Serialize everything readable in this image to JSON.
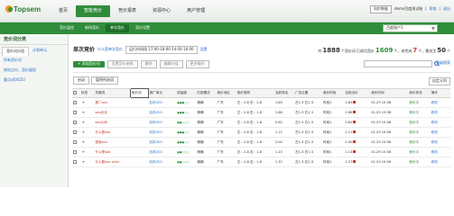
{
  "header": {
    "logo_text": "Topsem",
    "nav": [
      "首页",
      "智能竞价",
      "竞价报表",
      "资源中心",
      "用户管理"
    ],
    "active_nav": 1,
    "top_btn": "同步数据",
    "user": "demo百度测试账",
    "logout_sep": "|",
    "logout": "退出",
    "help": "帮助"
  },
  "subnav": {
    "items": [
      "竞价监控",
      "新排竞价",
      "单次竞价",
      "竞价设置"
    ],
    "active": 2,
    "account": "百度账户1"
  },
  "sidebar": {
    "title": "竞价词分类",
    "tabs": [
      "竞价词分组",
      "计划单元"
    ],
    "links": [
      "所有竞价词",
      "按站点分，竞价展现",
      "重点词OOZU"
    ]
  },
  "main": {
    "title": "单次竞价",
    "title_link": "什么是单次竞价",
    "period": "运行时间段 17:00-18:00 14:00-16:00",
    "set": "设置",
    "stats": {
      "pre1": "共",
      "total": "1888",
      "post1": "个竞价词",
      "pre2": "已成功竞价",
      "success": "1609",
      "post2": "个，未完成",
      "fail": "7",
      "post3": "个，需关注",
      "alert": "50",
      "post4": "个"
    },
    "toolbar": {
      "add": "+ 添加竞价词",
      "b1": "设置竞价参数",
      "b2": "删除",
      "b3": "编辑分组",
      "b4": "更多操作"
    },
    "search_placeholder": "",
    "advanced": "高级搜索",
    "filter": [
      "启动",
      "暂停所选项"
    ],
    "columns_btn": "自定义列"
  },
  "table": {
    "headers": [
      "",
      "状态",
      "关键词",
      "竞价词",
      "推广单元",
      "质量度",
      "匹配模式",
      "竞价地区",
      "竞价规则",
      "当前排名",
      "广告位置",
      "竞价时段",
      "目前出价",
      "竞价时间",
      "竞价状态",
      "操作"
    ],
    "rows": [
      {
        "kw": "推广seo",
        "plan": "站内SEO",
        "q": "●●●○○",
        "match": "精确",
        "area": "广东",
        "rule": "左：2-8 右：1-8",
        "rank": "1.85",
        "pos": "左1-3 右1-3",
        "period": "时段1",
        "bid": "1.85",
        "time": "01-29 15:58",
        "status": "竞价中",
        "op": "修改"
      },
      {
        "kw": "seo优化",
        "plan": "站内SEO",
        "q": "●●●○○",
        "match": "精确",
        "area": "广东",
        "rule": "左：2-8 右：1-8",
        "rank": "1.86",
        "pos": "左1-3 右1-3",
        "period": "时段1",
        "bid": "1.86",
        "time": "01-29 15:58",
        "status": "竞价中",
        "op": "修改"
      },
      {
        "kw": "seo大师",
        "plan": "站内SEO",
        "q": "●●○○○",
        "match": "精确",
        "area": "广东",
        "rule": "左：2-8 右：1-8",
        "rank": "0.62",
        "pos": "左1-3 右1-3",
        "period": "时段1",
        "bid": "0.62",
        "time": "01-29 15:58",
        "status": "竞价中",
        "op": "修改"
      },
      {
        "kw": "什么是seo",
        "plan": "站内SEO",
        "q": "●●●○○",
        "match": "精确",
        "area": "广东",
        "rule": "左：2-8 右：1-8",
        "rank": "1.11",
        "pos": "左1-3 右1-3",
        "period": "时段1",
        "bid": "1.11",
        "time": "01-29 15:58",
        "status": "竞价中",
        "op": "修改"
      },
      {
        "kw": "搜索seo",
        "plan": "站内SEO",
        "q": "●●●○○",
        "match": "精确",
        "area": "广东",
        "rule": "左：2-8 右：1-8",
        "rank": "2.00",
        "pos": "左1-3 右1-3",
        "period": "时段1",
        "bid": "2.00",
        "time": "01-29 15:58",
        "status": "竞价中",
        "op": "修改"
      },
      {
        "kw": "什么是seo",
        "plan": "站内SEO",
        "q": "●●○○○",
        "match": "精确",
        "area": "广东",
        "rule": "左：2-8 右：1-8",
        "rank": "1.13",
        "pos": "左1-3 右1-3",
        "period": "时段1",
        "bid": "1.13",
        "time": "01-29 15:58",
        "status": "竞价中",
        "op": "修改"
      },
      {
        "kw": "什么是seo semi",
        "plan": "站内SEO",
        "q": "●●○○○",
        "match": "精确",
        "area": "广东",
        "rule": "左：2-8 右：1-8",
        "rank": "1.37",
        "pos": "左1-3 右1-3",
        "period": "时段1",
        "bid": "1.37",
        "time": "01-29 15:58",
        "status": "竞价中",
        "op": "修改"
      }
    ]
  }
}
